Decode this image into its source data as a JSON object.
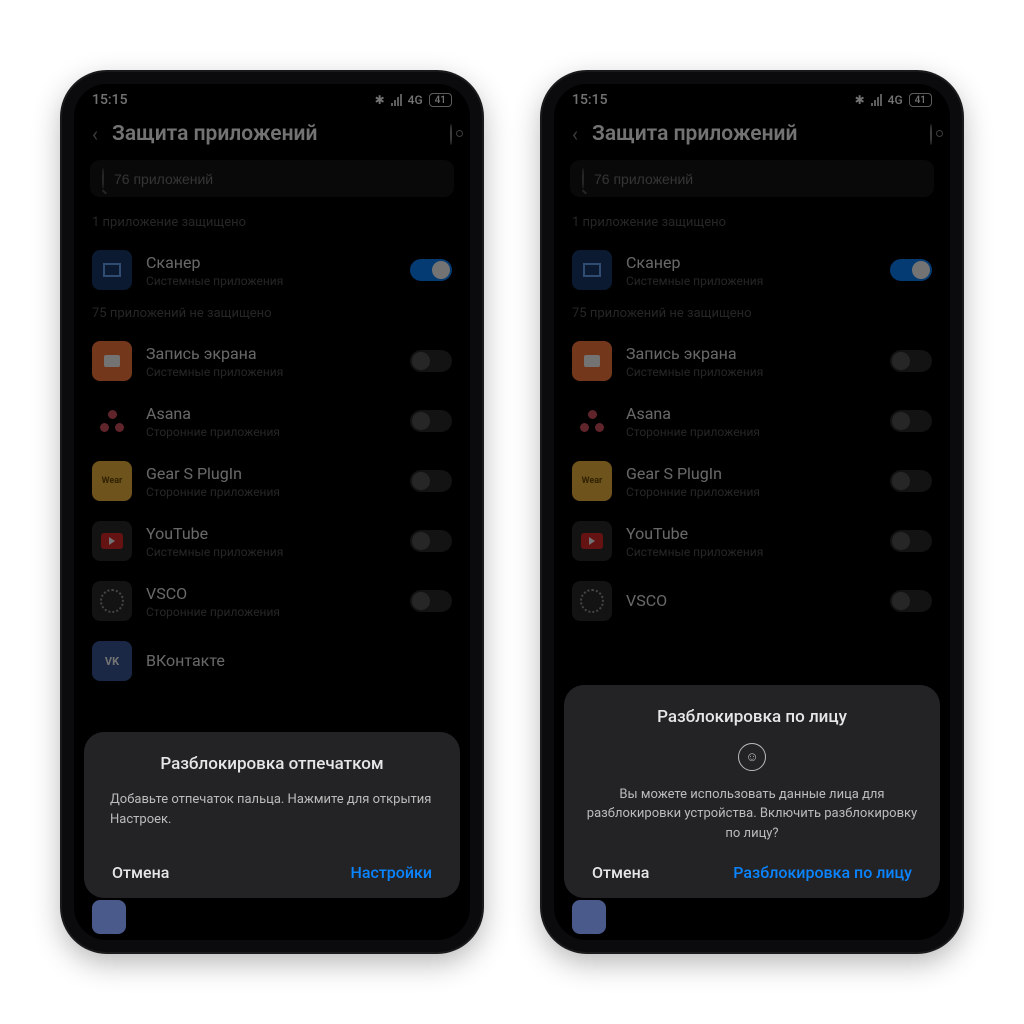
{
  "status": {
    "time": "15:15",
    "network": "4G",
    "battery": "41"
  },
  "header": {
    "title": "Защита приложений"
  },
  "search": {
    "placeholder": "76 приложений"
  },
  "sections": {
    "protected_label": "1 приложение защищено",
    "unprotected_label": "75 приложений не защищено"
  },
  "apps": {
    "scanner": {
      "name": "Сканер",
      "sub": "Системные приложения"
    },
    "record": {
      "name": "Запись экрана",
      "sub": "Системные приложения"
    },
    "asana": {
      "name": "Asana",
      "sub": "Сторонние приложения"
    },
    "gear_s": {
      "name": "Gear S PlugIn",
      "sub": "Сторонние приложения"
    },
    "youtube": {
      "name": "YouTube",
      "sub": "Системные приложения"
    },
    "vsco": {
      "name": "VSCO",
      "sub": "Сторонние приложения"
    },
    "vk": {
      "name": "ВКонтакте",
      "sub": ""
    }
  },
  "dialog_left": {
    "title": "Разблокировка отпечатком",
    "body": "Добавьте отпечаток пальца. Нажмите для открытия Настроек.",
    "cancel": "Отмена",
    "confirm": "Настройки"
  },
  "dialog_right": {
    "title": "Разблокировка по лицу",
    "body": "Вы можете использовать данные лица для разблокировки устройства. Включить разблокировку по лицу?",
    "cancel": "Отмена",
    "confirm": "Разблокировка по лицу"
  },
  "colors": {
    "accent": "#0a84ff"
  }
}
